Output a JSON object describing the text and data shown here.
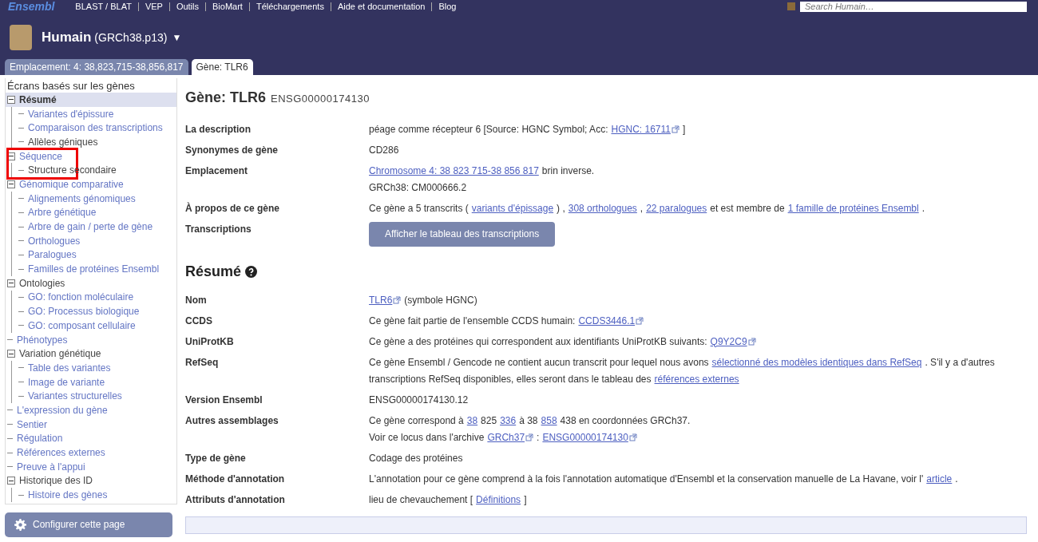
{
  "top_nav": {
    "logo": "Ensembl",
    "links": [
      "BLAST / BLAT",
      "VEP",
      "Outils",
      "BioMart",
      "Téléchargements",
      "Aide et documentation",
      "Blog"
    ],
    "search": {
      "placeholder": "Search Humain…"
    }
  },
  "species": {
    "name": "Humain",
    "assembly": "(GRCh38.p13)",
    "caret": "▼"
  },
  "tabs": [
    {
      "label": "Emplacement: 4: 38,823,715-38,856,817",
      "selected": false
    },
    {
      "label": "Gène: TLR6",
      "selected": true
    }
  ],
  "sidebar": {
    "title": "Écrans basés sur les gènes",
    "items": [
      {
        "label": "Résumé",
        "selected": true,
        "available": true,
        "expanded": true,
        "children": [
          {
            "label": "Variantes d'épissure",
            "selected": false,
            "available": true
          },
          {
            "label": "Comparaison des transcriptions",
            "selected": false,
            "available": true
          },
          {
            "label": "Allèles géniques",
            "selected": false,
            "available": false
          }
        ]
      },
      {
        "label": "Séquence",
        "selected": false,
        "available": true,
        "expanded": true,
        "highlighted": true,
        "children": [
          {
            "label": "Structure secondaire",
            "selected": false,
            "available": false
          }
        ]
      },
      {
        "label": "Génomique comparative",
        "selected": false,
        "available": true,
        "expanded": true,
        "children": [
          {
            "label": "Alignements génomiques",
            "selected": false,
            "available": true
          },
          {
            "label": "Arbre génétique",
            "selected": false,
            "available": true
          },
          {
            "label": "Arbre de gain / perte de gène",
            "selected": false,
            "available": true
          },
          {
            "label": "Orthologues",
            "selected": false,
            "available": true
          },
          {
            "label": "Paralogues",
            "selected": false,
            "available": true
          },
          {
            "label": "Familles de protéines Ensembl",
            "selected": false,
            "available": true
          }
        ]
      },
      {
        "label": "Ontologies",
        "selected": false,
        "available": false,
        "expanded": true,
        "children": [
          {
            "label": "GO: fonction moléculaire",
            "selected": false,
            "available": true
          },
          {
            "label": "GO: Processus biologique",
            "selected": false,
            "available": true
          },
          {
            "label": "GO: composant cellulaire",
            "selected": false,
            "available": true
          }
        ]
      },
      {
        "label": "Phénotypes",
        "selected": false,
        "available": true
      },
      {
        "label": "Variation génétique",
        "selected": false,
        "available": false,
        "expanded": true,
        "children": [
          {
            "label": "Table des variantes",
            "selected": false,
            "available": true
          },
          {
            "label": "Image de variante",
            "selected": false,
            "available": true
          },
          {
            "label": "Variantes structurelles",
            "selected": false,
            "available": true
          }
        ]
      },
      {
        "label": "L'expression du gène",
        "selected": false,
        "available": true
      },
      {
        "label": "Sentier",
        "selected": false,
        "available": true
      },
      {
        "label": "Régulation",
        "selected": false,
        "available": true
      },
      {
        "label": "Références externes",
        "selected": false,
        "available": true
      },
      {
        "label": "Preuve à l'appui",
        "selected": false,
        "available": true
      },
      {
        "label": "Historique des ID",
        "selected": false,
        "available": false,
        "expanded": true,
        "children": [
          {
            "label": "Histoire des gènes",
            "selected": false,
            "available": true
          }
        ]
      }
    ],
    "configure_button": "Configurer cette page"
  },
  "gene_header": {
    "title": "Gène: TLR6",
    "id": "ENSG00000174130"
  },
  "gene_rows": [
    {
      "label": "La description",
      "kind": "text",
      "lines": [
        [
          {
            "kind": "text",
            "text": "péage comme récepteur 6 [Source: HGNC Symbol; Acc:"
          },
          {
            "kind": "ext_link",
            "text": "HGNC: 16711"
          },
          {
            "kind": "text",
            "text": "]"
          }
        ]
      ]
    },
    {
      "label": "Synonymes de gène",
      "kind": "text",
      "lines": [
        [
          {
            "kind": "text",
            "text": "CD286"
          }
        ]
      ]
    },
    {
      "label": "Emplacement",
      "kind": "text",
      "lines": [
        [
          {
            "kind": "link",
            "text": "Chromosome 4: 38 823 715-38 856 817"
          },
          {
            "kind": "text",
            "text": "brin inverse."
          }
        ],
        [
          {
            "kind": "text",
            "text": "GRCh38: CM000666.2"
          }
        ]
      ]
    },
    {
      "label": "À propos de ce gène",
      "kind": "text",
      "lines": [
        [
          {
            "kind": "text",
            "text": "Ce gène a 5 transcrits ("
          },
          {
            "kind": "link",
            "text": "variants d'épissage"
          },
          {
            "kind": "text",
            "text": ") ,"
          },
          {
            "kind": "link",
            "text": "308 orthologues"
          },
          {
            "kind": "text",
            "text": ","
          },
          {
            "kind": "link",
            "text": "22 paralogues"
          },
          {
            "kind": "text",
            "text": "et est membre de"
          },
          {
            "kind": "link",
            "text": "1 famille de protéines Ensembl"
          },
          {
            "kind": "text",
            "text": "."
          }
        ]
      ]
    },
    {
      "label": "Transcriptions",
      "kind": "button",
      "button": "Afficher le tableau des transcriptions"
    }
  ],
  "summary": {
    "title": "Résumé",
    "rows": [
      {
        "label": "Nom",
        "kind": "text",
        "lines": [
          [
            {
              "kind": "ext_link",
              "text": "TLR6"
            },
            {
              "kind": "text",
              "text": "(symbole HGNC)"
            }
          ]
        ]
      },
      {
        "label": "CCDS",
        "kind": "text",
        "lines": [
          [
            {
              "kind": "text",
              "text": "Ce gène fait partie de l'ensemble CCDS humain:"
            },
            {
              "kind": "ext_link",
              "text": "CCDS3446.1"
            }
          ]
        ]
      },
      {
        "label": "UniProtKB",
        "kind": "text",
        "lines": [
          [
            {
              "kind": "text",
              "text": "Ce gène a des protéines qui correspondent aux identifiants UniProtKB suivants:"
            },
            {
              "kind": "ext_link",
              "text": "Q9Y2C9"
            }
          ]
        ]
      },
      {
        "label": "RefSeq",
        "kind": "text",
        "lines": [
          [
            {
              "kind": "text",
              "text": "Ce gène Ensembl / Gencode ne contient aucun transcrit pour lequel nous avons"
            },
            {
              "kind": "link",
              "text": "sélectionné des modèles identiques dans RefSeq"
            },
            {
              "kind": "text",
              "text": ". S'il y a d'autres"
            }
          ],
          [
            {
              "kind": "text",
              "text": "transcriptions RefSeq disponibles, elles seront dans le tableau des"
            },
            {
              "kind": "link",
              "text": "références externes"
            }
          ]
        ]
      },
      {
        "label": "Version Ensembl",
        "kind": "text",
        "lines": [
          [
            {
              "kind": "text",
              "text": "ENSG00000174130.12"
            }
          ]
        ]
      },
      {
        "label": "Autres assemblages",
        "kind": "text",
        "lines": [
          [
            {
              "kind": "text",
              "text": "Ce gène correspond à"
            },
            {
              "kind": "link",
              "text": "38"
            },
            {
              "kind": "text",
              "text": "825"
            },
            {
              "kind": "link",
              "text": "336"
            },
            {
              "kind": "text",
              "text": "à 38"
            },
            {
              "kind": "link",
              "text": "858"
            },
            {
              "kind": "text",
              "text": "438 en coordonnées GRCh37."
            }
          ],
          [
            {
              "kind": "text",
              "text": "Voir ce locus dans l'archive"
            },
            {
              "kind": "ext_link",
              "text": "GRCh37"
            },
            {
              "kind": "text",
              "text": ":"
            },
            {
              "kind": "ext_link",
              "text": "ENSG00000174130"
            }
          ]
        ]
      },
      {
        "label": "Type de gène",
        "kind": "text",
        "lines": [
          [
            {
              "kind": "text",
              "text": "Codage des protéines"
            }
          ]
        ]
      },
      {
        "label": "Méthode d'annotation",
        "kind": "text",
        "lines": [
          [
            {
              "kind": "text",
              "text": "L'annotation pour ce gène comprend à la fois l'annotation automatique d'Ensembl et la conservation manuelle de La Havane, voir l'"
            },
            {
              "kind": "link",
              "text": "article"
            },
            {
              "kind": "text",
              "text": "."
            }
          ]
        ]
      },
      {
        "label": "Attributs d'annotation",
        "kind": "text",
        "lines": [
          [
            {
              "kind": "text",
              "text": "lieu de chevauchement ["
            },
            {
              "kind": "link",
              "text": "Définitions"
            },
            {
              "kind": "text",
              "text": "]"
            }
          ]
        ]
      }
    ]
  }
}
